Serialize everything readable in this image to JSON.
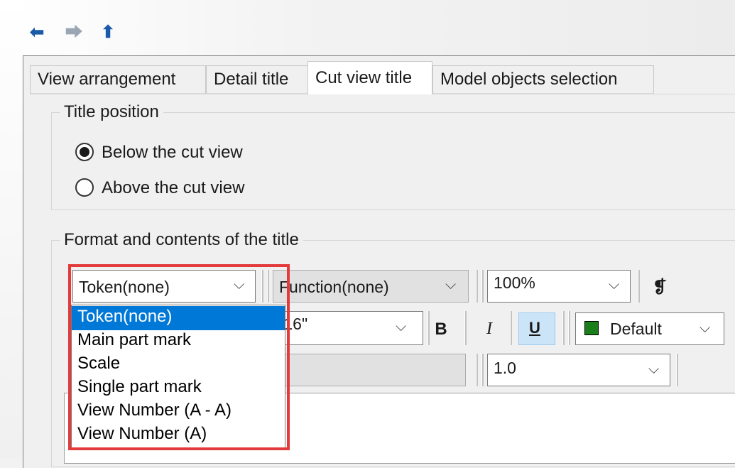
{
  "nav": {
    "back_icon": "arrow-left-icon",
    "forward_icon": "arrow-right-icon",
    "up_icon": "arrow-up-icon"
  },
  "tabs": [
    {
      "label": "View arrangement",
      "active": false
    },
    {
      "label": "Detail title",
      "active": false
    },
    {
      "label": "Cut view title",
      "active": true
    },
    {
      "label": "Model objects selection",
      "active": false
    }
  ],
  "title_position": {
    "label": "Title position",
    "options": [
      {
        "label": "Below the cut view",
        "selected": true
      },
      {
        "label": "Above the cut view",
        "selected": false
      }
    ]
  },
  "format": {
    "label": "Format and contents of the title",
    "token_combo": "Token(none)",
    "function_combo": "Function(none)",
    "zoom_combo": "100%",
    "paragraph_icon": "paragraph-icon",
    "size_combo": "/16\"",
    "bold_label": "B",
    "italic_label": "I",
    "underline_label": "U",
    "color_combo": "Default",
    "color_swatch": "#1a7f1a",
    "spacing_combo": "1.0"
  },
  "token_dropdown": {
    "items": [
      "Token(none)",
      "Main part mark",
      "Scale",
      "Single part mark",
      "View Number (A - A)",
      "View Number (A)"
    ],
    "selected_index": 0
  },
  "colors": {
    "selection": "#0078d7",
    "highlight_box": "#e33b3b"
  }
}
